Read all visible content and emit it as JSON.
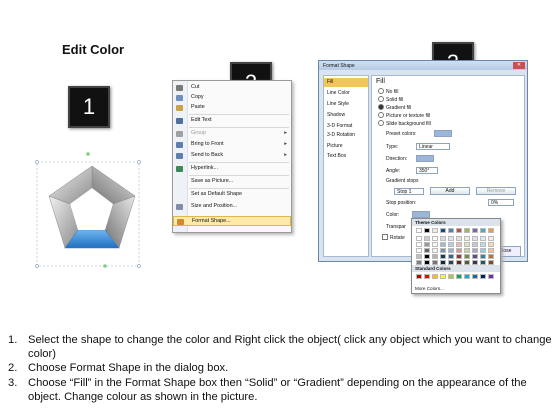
{
  "title": "Edit Color",
  "badges": [
    "1",
    "2",
    "3"
  ],
  "context_menu": {
    "items": [
      {
        "label": "Cut",
        "icon": "scissors-icon",
        "icon_color": "#7a7a7a",
        "arrow": "",
        "state": "normal"
      },
      {
        "label": "Copy",
        "icon": "copy-icon",
        "icon_color": "#6f8fbf",
        "arrow": "",
        "state": "normal"
      },
      {
        "label": "Paste",
        "icon": "paste-icon",
        "icon_color": "#c9a24a",
        "arrow": "",
        "state": "normal"
      },
      {
        "label": "Edit Text",
        "icon": "edit-text-icon",
        "icon_color": "#4f6f9f",
        "arrow": "",
        "state": "normal"
      },
      {
        "label": "Group",
        "icon": "group-icon",
        "icon_color": "#a0a0a0",
        "arrow": "▸",
        "state": "dim"
      },
      {
        "label": "Bring to Front",
        "icon": "bring-front-icon",
        "icon_color": "#5d7fb0",
        "arrow": "▸",
        "state": "normal"
      },
      {
        "label": "Send to Back",
        "icon": "send-back-icon",
        "icon_color": "#5d7fb0",
        "arrow": "▸",
        "state": "normal"
      },
      {
        "label": "Hyperlink...",
        "icon": "hyperlink-icon",
        "icon_color": "#3a8a5a",
        "arrow": "",
        "state": "normal"
      },
      {
        "label": "Save as Picture...",
        "icon": "",
        "icon_color": "",
        "arrow": "",
        "state": "normal"
      },
      {
        "label": "Set as Default Shape",
        "icon": "",
        "icon_color": "",
        "arrow": "",
        "state": "normal"
      },
      {
        "label": "Size and Position...",
        "icon": "size-icon",
        "icon_color": "#7f8fa8",
        "arrow": "",
        "state": "normal"
      },
      {
        "label": "Format Shape...",
        "icon": "format-shape-icon",
        "icon_color": "#d08a2a",
        "arrow": "",
        "state": "highlight"
      }
    ]
  },
  "dialog": {
    "title": "Format Shape",
    "nav": [
      "Fill",
      "Line Color",
      "Line Style",
      "Shadow",
      "3-D Format",
      "3-D Rotation",
      "Picture",
      "Text Box"
    ],
    "nav_selected": "Fill",
    "heading": "Fill",
    "fill_options": [
      {
        "label": "No fill",
        "on": false
      },
      {
        "label": "Solid fill",
        "on": false
      },
      {
        "label": "Gradient fill",
        "on": true
      },
      {
        "label": "Picture or texture fill",
        "on": false
      },
      {
        "label": "Slide background fill",
        "on": false
      }
    ],
    "preset_label": "Preset colors:",
    "type_label": "Type:",
    "type_value": "Linear",
    "direction_label": "Direction:",
    "angle_label": "Angle:",
    "angle_value": "350°",
    "stops_label": "Gradient stops",
    "stop_value": "Stop 1",
    "add_label": "Add",
    "remove_label": "Remove",
    "stop_position_label": "Stop position:",
    "stop_position_value": "0%",
    "color_label": "Color:",
    "transparency_label": "Transpar",
    "rotate_label": "Rotate",
    "close_label": "Close"
  },
  "theme_popup": {
    "theme_header": "Theme Colors",
    "standard_header": "Standard Colors",
    "more_label": "More Colors...",
    "theme_top": [
      "#ffffff",
      "#000000",
      "#eeece1",
      "#1f497d",
      "#4f81bd",
      "#c0504d",
      "#9bbb59",
      "#8064a2",
      "#4bacc6",
      "#f79646"
    ],
    "standard": [
      "#c00000",
      "#ff0000",
      "#ffc000",
      "#ffff00",
      "#92d050",
      "#00b050",
      "#00b0f0",
      "#0070c0",
      "#002060",
      "#7030a0"
    ]
  },
  "steps": [
    {
      "num": "1.",
      "text": "Select the shape to change the color and Right click the object( click any object which you want to change color)"
    },
    {
      "num": "2.",
      "text": "Choose Format Shape in the dialog box."
    },
    {
      "num": "3.",
      "text": "Choose “Fill” in the Format Shape box then “Solid” or “Gradient” depending on the appearance of the object. Change colour as shown in the picture."
    }
  ]
}
